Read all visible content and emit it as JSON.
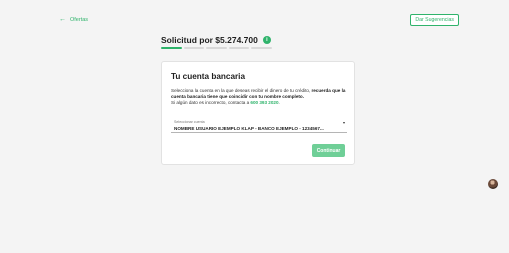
{
  "nav": {
    "back_label": "Ofertas",
    "suggestions_label": "Dar Sugerencias"
  },
  "header": {
    "title": "Solicitud por $5.274.700",
    "info_symbol": "i",
    "progress": {
      "total_steps": 5,
      "current_step": 1
    }
  },
  "card": {
    "title": "Tu cuenta bancaria",
    "text_part1": "Selecciona la cuenta en la que deseas recibir el dinero de tu crédito, ",
    "text_bold": "recuerda que la cuenta bancaria tiene que coincidir con tu nombre completo.",
    "text_part2": "Si algún dato es incorrecto, contacta a ",
    "phone": "600 393 2020",
    "text_end": ".",
    "select": {
      "label": "Seleccionar cuenta",
      "value": "NOMBRE USUARIO EJEMPLO KLAP - BANCO EJEMPLO - 1234567..."
    },
    "continue_label": "Continuar"
  },
  "colors": {
    "accent": "#2fb36b",
    "button": "#6fcf97",
    "background": "#f4f4f4"
  }
}
